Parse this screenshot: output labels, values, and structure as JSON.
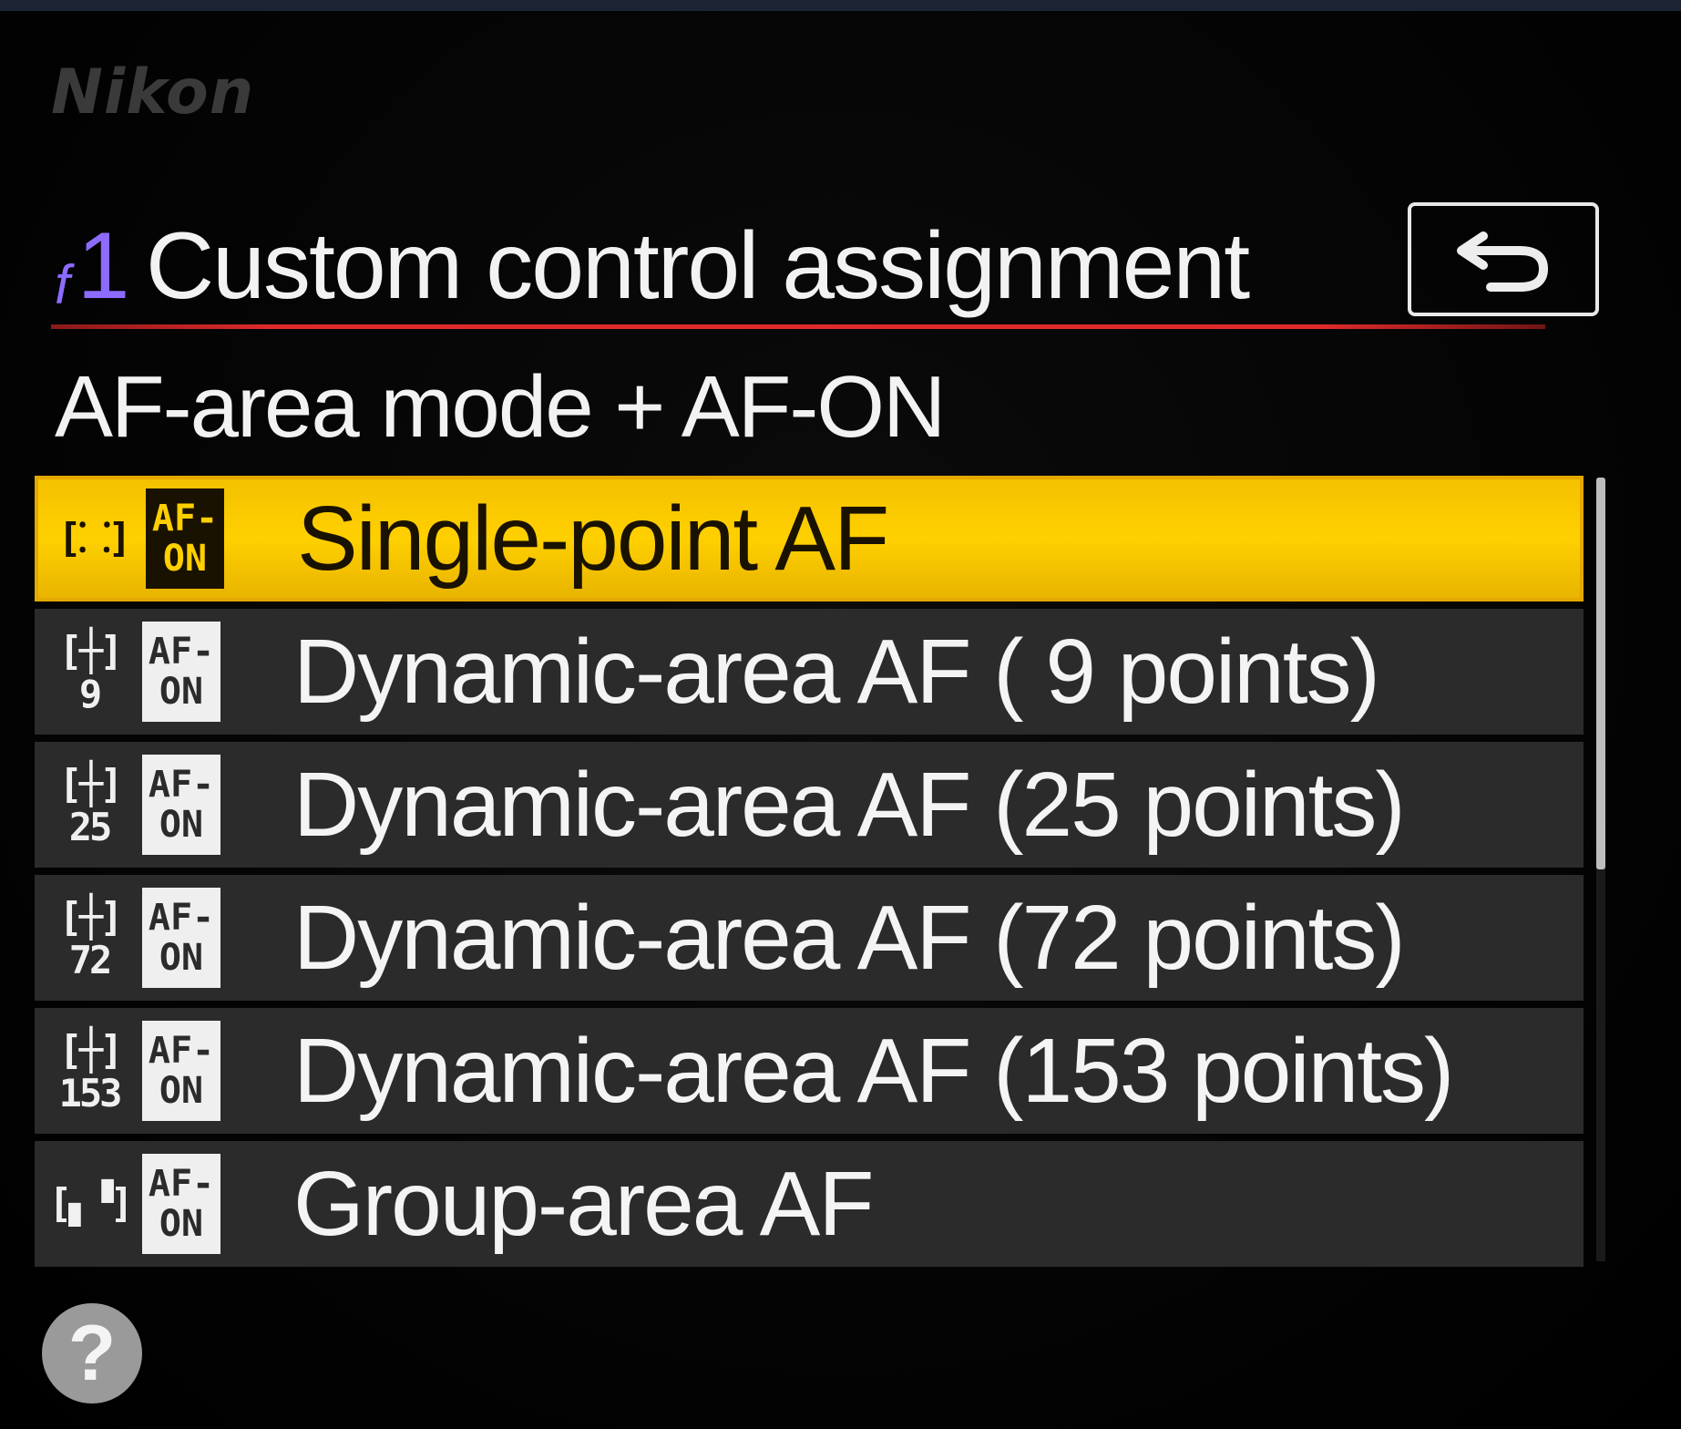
{
  "brand": "Nikon",
  "header": {
    "menu_code_prefix": "f",
    "menu_code_number": "1",
    "title": "Custom control assignment",
    "back_icon": "return-arrow-icon"
  },
  "subtitle": "AF-area mode + AF-ON",
  "list": {
    "selected_index": 0,
    "items": [
      {
        "icon": "single-point-af-icon",
        "points": "",
        "badge_top": "AF-",
        "badge_bottom": "ON",
        "label": "Single-point AF"
      },
      {
        "icon": "dynamic-area-af-icon",
        "points": "9",
        "badge_top": "AF-",
        "badge_bottom": "ON",
        "label": "Dynamic-area AF ( 9 points)"
      },
      {
        "icon": "dynamic-area-af-icon",
        "points": "25",
        "badge_top": "AF-",
        "badge_bottom": "ON",
        "label": "Dynamic-area AF (25 points)"
      },
      {
        "icon": "dynamic-area-af-icon",
        "points": "72",
        "badge_top": "AF-",
        "badge_bottom": "ON",
        "label": "Dynamic-area AF (72 points)"
      },
      {
        "icon": "dynamic-area-af-icon",
        "points": "153",
        "badge_top": "AF-",
        "badge_bottom": "ON",
        "label": "Dynamic-area AF (153 points)"
      },
      {
        "icon": "group-area-af-icon",
        "points": "",
        "badge_top": "AF-",
        "badge_bottom": "ON",
        "label": "Group-area AF"
      }
    ]
  },
  "scroll_position": 0.5,
  "help": {
    "icon": "help-icon",
    "glyph": "?"
  },
  "colors": {
    "selection": "#ffd000",
    "accent_rule": "#e02a2a",
    "menu_code": "#8d6bff",
    "item_background": "#2b2b2b"
  }
}
